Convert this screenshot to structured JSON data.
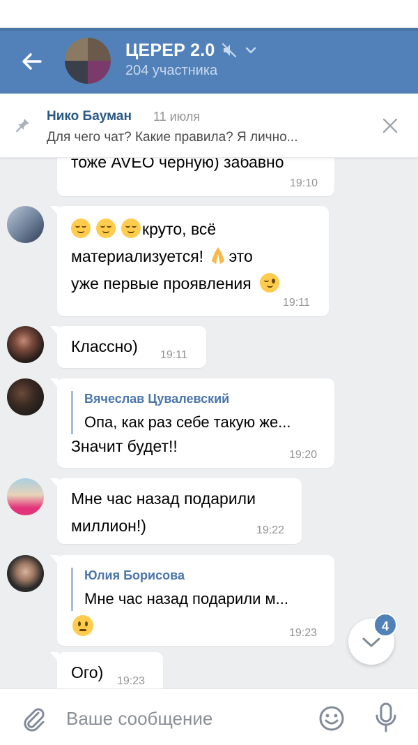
{
  "header": {
    "title": "ЦЕРЕР 2.0",
    "subtitle": "204 участника"
  },
  "pinned": {
    "author": "Нико Бауман",
    "date": "11 июля",
    "text": "Для чего чат? Какие правила?  Я лично..."
  },
  "messages": [
    {
      "text": "тоже AVEO черную) забавно",
      "time": "19:10"
    },
    {
      "text_line1": "круто, всё",
      "text_line2": "материализуется!",
      "text_line2b": "это",
      "text_line3": "уже первые проявления",
      "time": "19:11"
    },
    {
      "text": "Классно)",
      "time": "19:11"
    },
    {
      "reply_name": "Вячеслав Цувалевский",
      "reply_text": "Опа, как раз себе такую же...",
      "text": "Значит будет!!",
      "time": "19:20"
    },
    {
      "text_line1": "Мне час назад подарили",
      "text_line2": "миллион!)",
      "time": "19:22"
    },
    {
      "reply_name": "Юлия Борисова",
      "reply_text": "Мне час назад подарили м...",
      "time": "19:23"
    },
    {
      "text": "Ого)",
      "time": "19:23"
    }
  ],
  "scroll_badge": "4",
  "composer": {
    "placeholder": "Ваше сообщение"
  },
  "colors": {
    "header": "#5181b8",
    "link": "#2a5885",
    "background": "#edeef0"
  }
}
